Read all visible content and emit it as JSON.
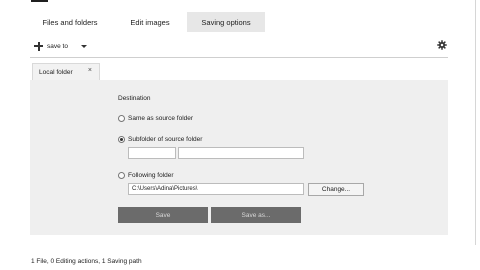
{
  "tabs": [
    "Files and folders",
    "Edit images",
    "Saving options"
  ],
  "toolbar": {
    "save_label": "save to"
  },
  "subtab": {
    "label": "Local folder",
    "close": "×"
  },
  "destination": {
    "title": "Destination",
    "options": [
      "Same as source folder",
      "Subfolder of source folder",
      "Following folder"
    ],
    "selected": 1,
    "subfolder_value": "",
    "folder_value": "C:\\Users\\Adina\\Pictures\\",
    "change_label": "Change..."
  },
  "actions": {
    "save_label": "Save",
    "save_as_label": "Save as..."
  },
  "status": "1 File, 0 Editing actions, 1 Saving path"
}
